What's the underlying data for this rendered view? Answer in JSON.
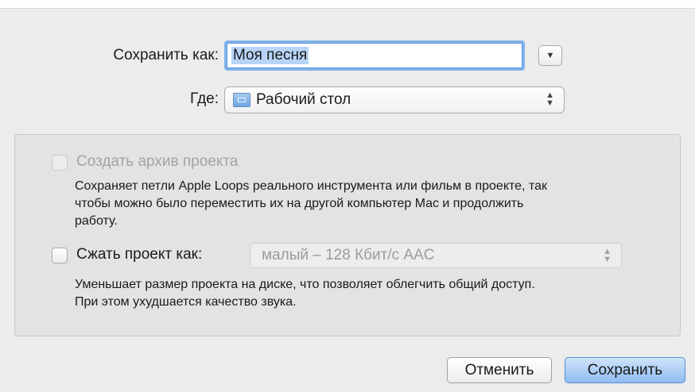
{
  "dialog": {
    "save_as_label": "Сохранить как:",
    "save_as_value": "Моя песня",
    "where_label": "Где:",
    "where_value": "Рабочий стол",
    "where_icon": "folder-icon"
  },
  "options": {
    "archive": {
      "label": "Создать архив проекта",
      "checked": false,
      "enabled": false,
      "description_lines": [
        "Сохраняет петли Apple Loops реального инструмента или фильм в проекте, так",
        "чтобы можно было переместить их на другой компьютер Mac и продолжить",
        "работу."
      ]
    },
    "compress": {
      "label": "Сжать проект как:",
      "checked": false,
      "enabled": true,
      "selected_value": "малый – 128 Кбит/с AAC",
      "description_lines": [
        "Уменьшает размер проекта на диске, что позволяет облегчить общий доступ.",
        "При этом ухудшается качество звука."
      ]
    }
  },
  "buttons": {
    "cancel_label": "Отменить",
    "save_label": "Сохранить"
  },
  "colors": {
    "focus_ring": "#7fb3ea",
    "default_button": "#8fbcf1",
    "disabled_text": "#a4a4a4"
  }
}
